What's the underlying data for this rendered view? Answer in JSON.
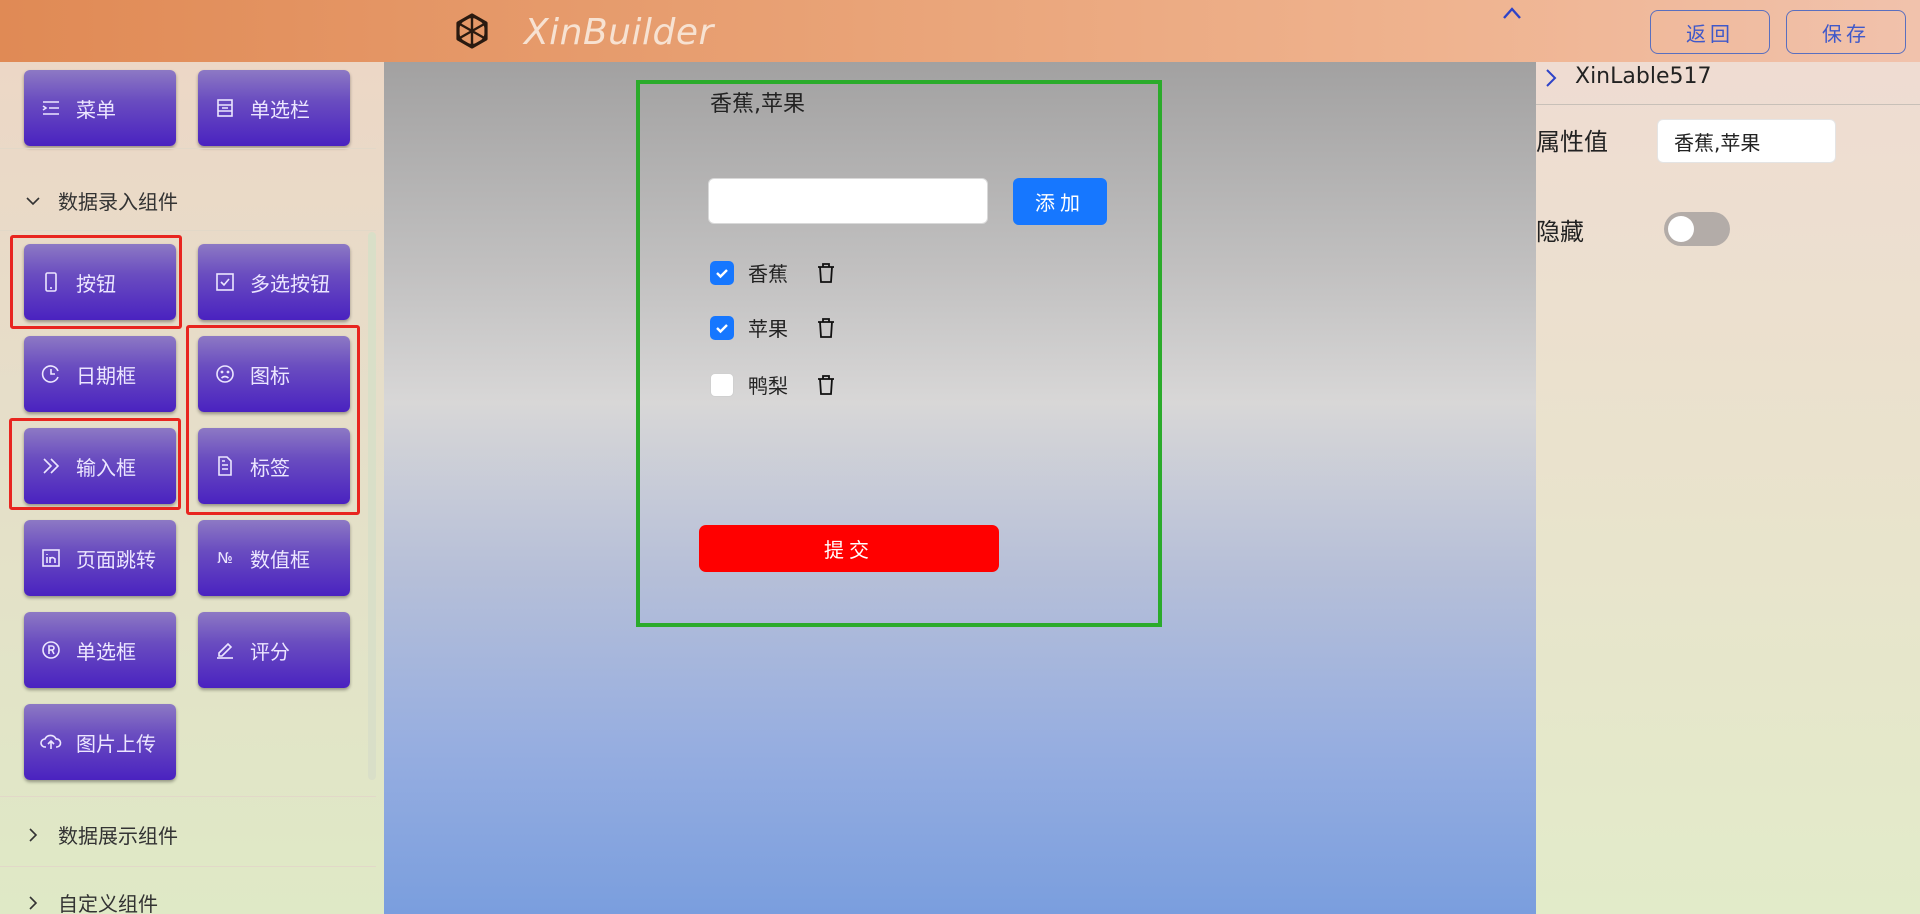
{
  "header": {
    "app_title": "XinBuilder",
    "back_label": "返回",
    "save_label": "保存",
    "logo_icon": "openai-logo-icon",
    "collapse_icon": "chevron-up-icon"
  },
  "sidebar": {
    "top_items": [
      {
        "label": "菜单",
        "icon": "menu-list-icon"
      },
      {
        "label": "单选栏",
        "icon": "radio-group-icon"
      }
    ],
    "data_entry_section": {
      "title": "数据录入组件",
      "items": [
        {
          "label": "按钮",
          "icon": "mobile-icon"
        },
        {
          "label": "多选按钮",
          "icon": "checkbox-icon"
        },
        {
          "label": "日期框",
          "icon": "clock-icon"
        },
        {
          "label": "图标",
          "icon": "frown-icon"
        },
        {
          "label": "输入框",
          "icon": "double-right-icon"
        },
        {
          "label": "标签",
          "icon": "file-text-icon"
        },
        {
          "label": "页面跳转",
          "icon": "linkedin-icon"
        },
        {
          "label": "数值框",
          "icon": "number-icon"
        },
        {
          "label": "单选框",
          "icon": "registered-icon"
        },
        {
          "label": "评分",
          "icon": "edit-icon"
        },
        {
          "label": "图片上传",
          "icon": "cloud-upload-icon"
        }
      ]
    },
    "display_section": {
      "title": "数据展示组件"
    },
    "custom_section": {
      "title": "自定义组件"
    }
  },
  "canvas": {
    "label_value": "香蕉,苹果",
    "add_input_value": "",
    "add_button_label": "添加",
    "options": [
      {
        "label": "香蕉",
        "checked": true
      },
      {
        "label": "苹果",
        "checked": true
      },
      {
        "label": "鸭梨",
        "checked": false
      }
    ],
    "submit_label": "提交"
  },
  "properties": {
    "component_name": "XinLable517",
    "value_label": "属性值",
    "value": "香蕉,苹果",
    "hidden_label": "隐藏",
    "hidden": false
  },
  "colors": {
    "primary": "#1677ff",
    "submit": "#ff0000",
    "frame": "#2bab2b",
    "highlight": "#e8251f",
    "component_button": "#4a22c0"
  }
}
